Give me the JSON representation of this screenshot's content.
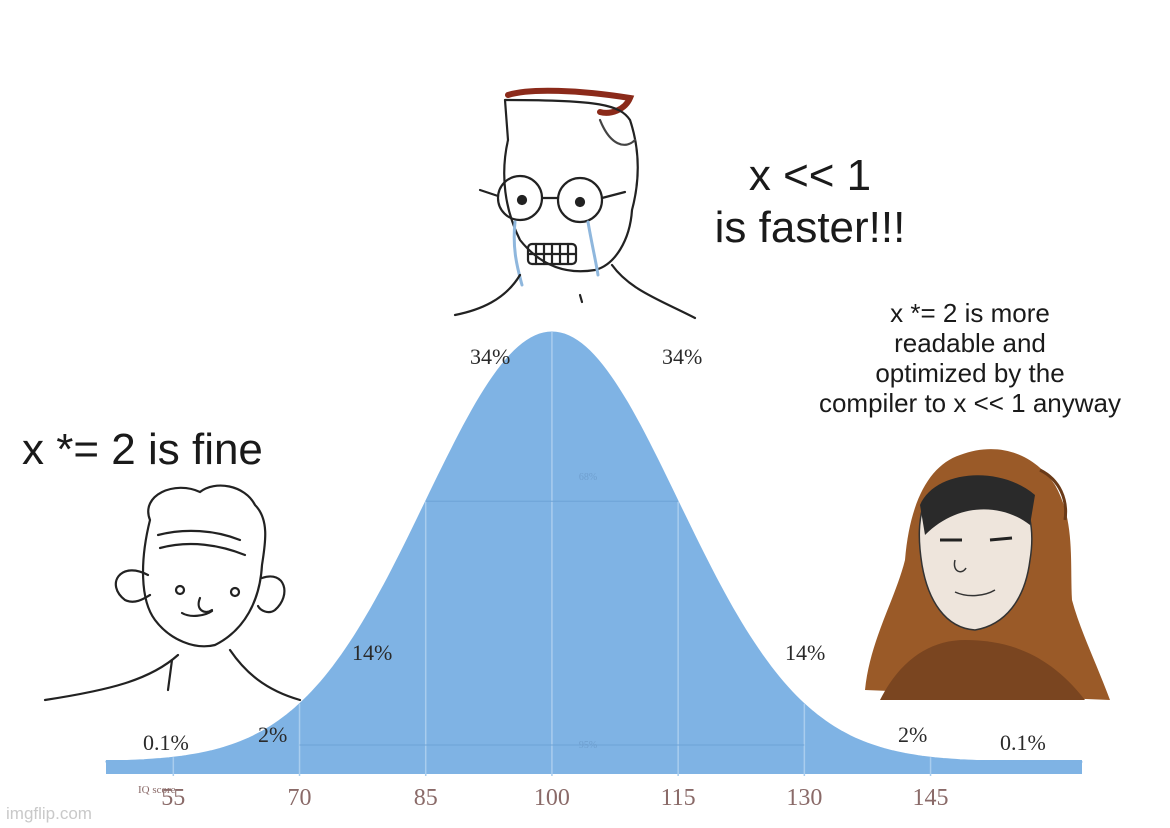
{
  "captions": {
    "left": "x *= 2 is fine",
    "middle_lines": [
      "x << 1",
      "is faster!!!"
    ],
    "right_lines": [
      "x *= 2 is more",
      "readable and",
      "optimized by the",
      "compiler to x << 1 anyway"
    ]
  },
  "chart_data": {
    "type": "area",
    "distribution": "normal",
    "mean": 100,
    "sd": 15,
    "xlim": [
      47,
      163
    ],
    "x_ticks": [
      55,
      70,
      85,
      100,
      115,
      130,
      145
    ],
    "x_tick_labels": [
      "55",
      "70",
      "85",
      "100",
      "115",
      "130",
      "145"
    ],
    "xlabel": "IQ score",
    "band_labels": [
      "68%",
      "95%"
    ],
    "region_labels": [
      "0.1%",
      "2%",
      "14%",
      "34%",
      "34%",
      "14%",
      "2%",
      "0.1%"
    ],
    "fill_color": "#7fb3e4",
    "divider_color": "#a9cdee"
  },
  "watermark": "imgflip.com",
  "characters": [
    {
      "role": "low-iq-wojak",
      "icon": "wojak-face-icon"
    },
    {
      "role": "midwit-crying-wojak",
      "icon": "crying-wojak-glasses-icon"
    },
    {
      "role": "hooded-genius",
      "icon": "hooded-figure-icon"
    }
  ]
}
